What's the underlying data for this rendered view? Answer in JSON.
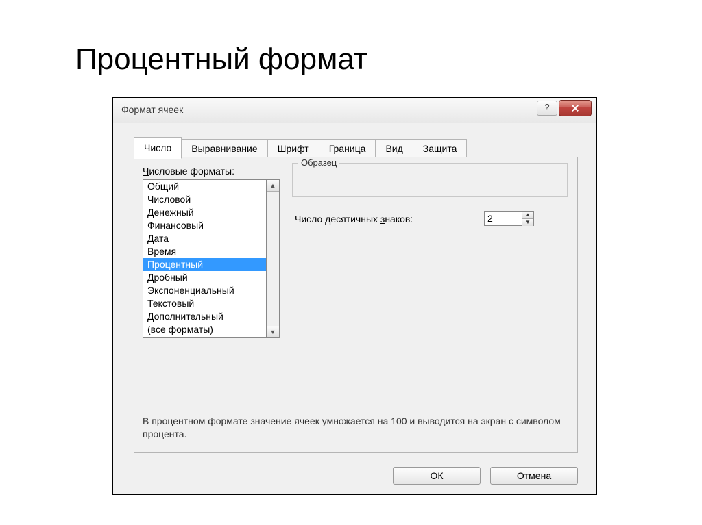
{
  "slide": {
    "title": "Процентный формат"
  },
  "dialog": {
    "title": "Формат ячеек",
    "tabs": [
      "Число",
      "Выравнивание",
      "Шрифт",
      "Граница",
      "Вид",
      "Защита"
    ],
    "active_tab": 0,
    "formats_label": "Числовые форматы:",
    "format_items": [
      "Общий",
      "Числовой",
      "Денежный",
      "Финансовый",
      "Дата",
      "Время",
      "Процентный",
      "Дробный",
      "Экспоненциальный",
      "Текстовый",
      "Дополнительный",
      "(все форматы)"
    ],
    "selected_format_index": 6,
    "sample_label": "Образец",
    "decimals_label": "Число десятичных знаков:",
    "decimals_value": "2",
    "description": "В процентном формате значение ячеек умножается на 100 и выводится на экран с символом процента.",
    "ok_label": "ОК",
    "cancel_label": "Отмена"
  }
}
